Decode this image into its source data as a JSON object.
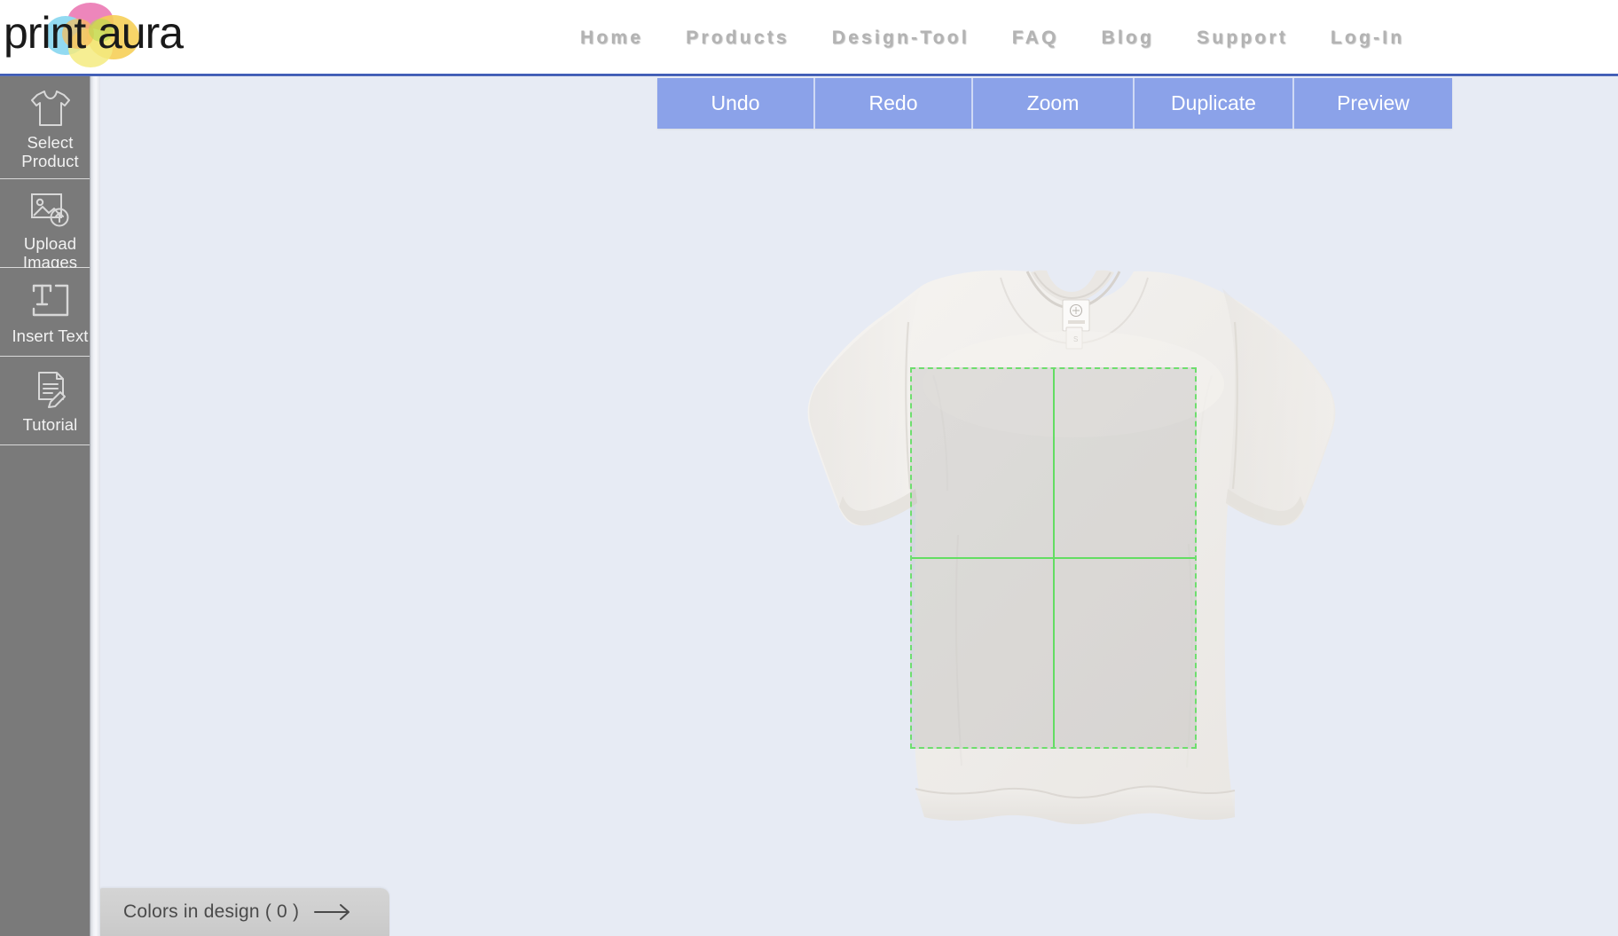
{
  "header": {
    "logo": {
      "name": "printaura-logo",
      "text_part1": "print",
      "text_part2": "aura",
      "colors": [
        "#f2d13a",
        "#eb72b0",
        "#7fd4ef",
        "#f5a623",
        "#a8d336"
      ]
    },
    "nav": [
      {
        "id": "home",
        "label": "Home"
      },
      {
        "id": "products",
        "label": "Products"
      },
      {
        "id": "design-tool",
        "label": "Design-Tool"
      },
      {
        "id": "faq",
        "label": "FAQ"
      },
      {
        "id": "blog",
        "label": "Blog"
      },
      {
        "id": "support",
        "label": "Support"
      },
      {
        "id": "login",
        "label": "Log-In"
      }
    ],
    "rule_color": "#3450ad"
  },
  "sidebar": {
    "background": "#7a7a7a",
    "items": [
      {
        "id": "select-product",
        "icon": "tshirt-icon",
        "label_line1": "Select",
        "label_line2": "Product"
      },
      {
        "id": "upload-images",
        "icon": "image-upload-icon",
        "label_line1": "Upload",
        "label_line2": "Images"
      },
      {
        "id": "insert-text",
        "icon": "text-box-icon",
        "label_line1": "Insert Text",
        "label_line2": ""
      },
      {
        "id": "tutorial",
        "icon": "document-pencil-icon",
        "label_line1": "Tutorial",
        "label_line2": ""
      }
    ]
  },
  "toolbar": {
    "background": "#8ba2e9",
    "buttons": [
      {
        "id": "undo",
        "label": "Undo"
      },
      {
        "id": "redo",
        "label": "Redo"
      },
      {
        "id": "zoom",
        "label": "Zoom"
      },
      {
        "id": "duplicate",
        "label": "Duplicate"
      },
      {
        "id": "preview",
        "label": "Preview"
      }
    ]
  },
  "canvas": {
    "background": "#e7ebf4",
    "product": {
      "name": "crop-tshirt",
      "color": "#f2f0ee",
      "description": "Womens cropped boxy t-shirt, front view, white/natural"
    },
    "print_area": {
      "name": "print-area",
      "border_color": "#6ede6e",
      "guide_color": "#63dd63",
      "fill": "rgba(120,120,120,0.17)"
    }
  },
  "footer": {
    "colors_in_design": {
      "label": "Colors in design ( 0 )",
      "count": 0,
      "arrow_icon": "arrow-right-icon"
    }
  }
}
